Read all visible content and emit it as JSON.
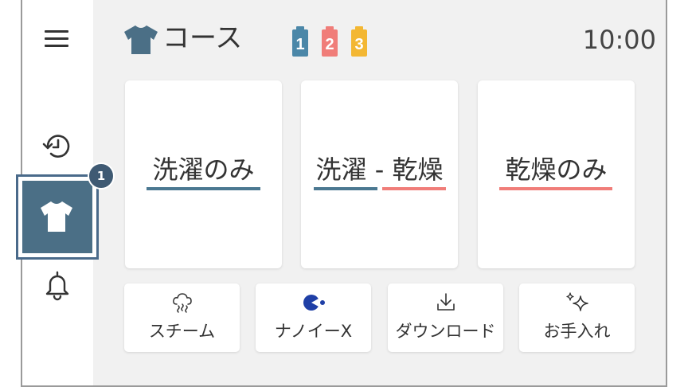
{
  "header": {
    "title": "コース",
    "time": "10:00",
    "tags": [
      {
        "label": "1",
        "color": "#4b87a8"
      },
      {
        "label": "2",
        "color": "#f07d79"
      },
      {
        "label": "3",
        "color": "#f3b733"
      }
    ]
  },
  "sidebar": {
    "badge": "1",
    "items": [
      {
        "icon": "menu-icon"
      },
      {
        "icon": "history-icon"
      },
      {
        "icon": "laundry-icon",
        "selected": true
      },
      {
        "icon": "bell-icon"
      }
    ]
  },
  "courses": [
    {
      "label": "洗濯のみ"
    },
    {
      "label": "洗濯 - 乾燥"
    },
    {
      "label": "乾燥のみ"
    }
  ],
  "functions": [
    {
      "label": "スチーム",
      "icon": "steam-icon"
    },
    {
      "label": "ナノイーX",
      "icon": "nanoe-icon"
    },
    {
      "label": "ダウンロード",
      "icon": "download-icon"
    },
    {
      "label": "お手入れ",
      "icon": "sparkle-icon"
    }
  ],
  "colors": {
    "wash": "#4b7891",
    "dry": "#f07d79",
    "accent": "#4b6f86",
    "badge": "#3f5a73",
    "nanoe": "#1f3fa6"
  }
}
